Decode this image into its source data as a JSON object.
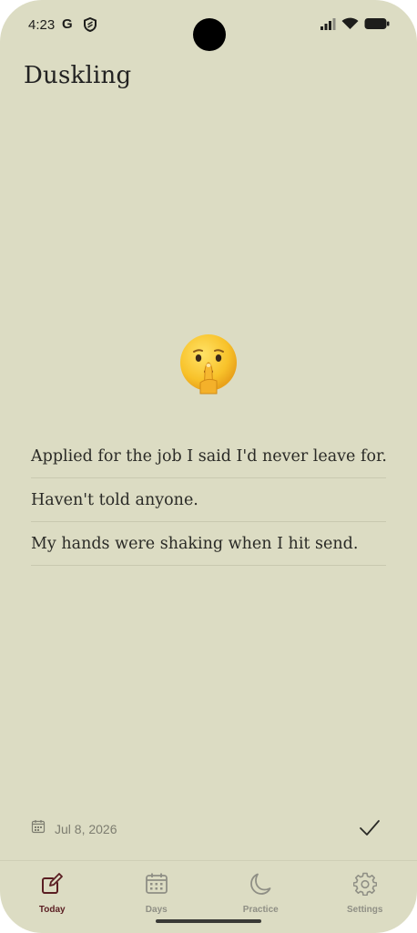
{
  "status_bar": {
    "time": "4:23",
    "g_letter": "G"
  },
  "app": {
    "title": "Duskling"
  },
  "entry": {
    "mood_icon": "shushing-face-emoji",
    "lines": [
      "Applied for the job I said I'd never leave for.",
      "Haven't told anyone.",
      "My hands were shaking when I hit send."
    ],
    "date": "Jul 8, 2026"
  },
  "nav": {
    "today": "Today",
    "days": "Days",
    "practice": "Practice",
    "settings": "Settings"
  },
  "colors": {
    "background": "#dcdcc3",
    "active_nav": "#5a1e22",
    "inactive_nav": "#8f8f85"
  }
}
